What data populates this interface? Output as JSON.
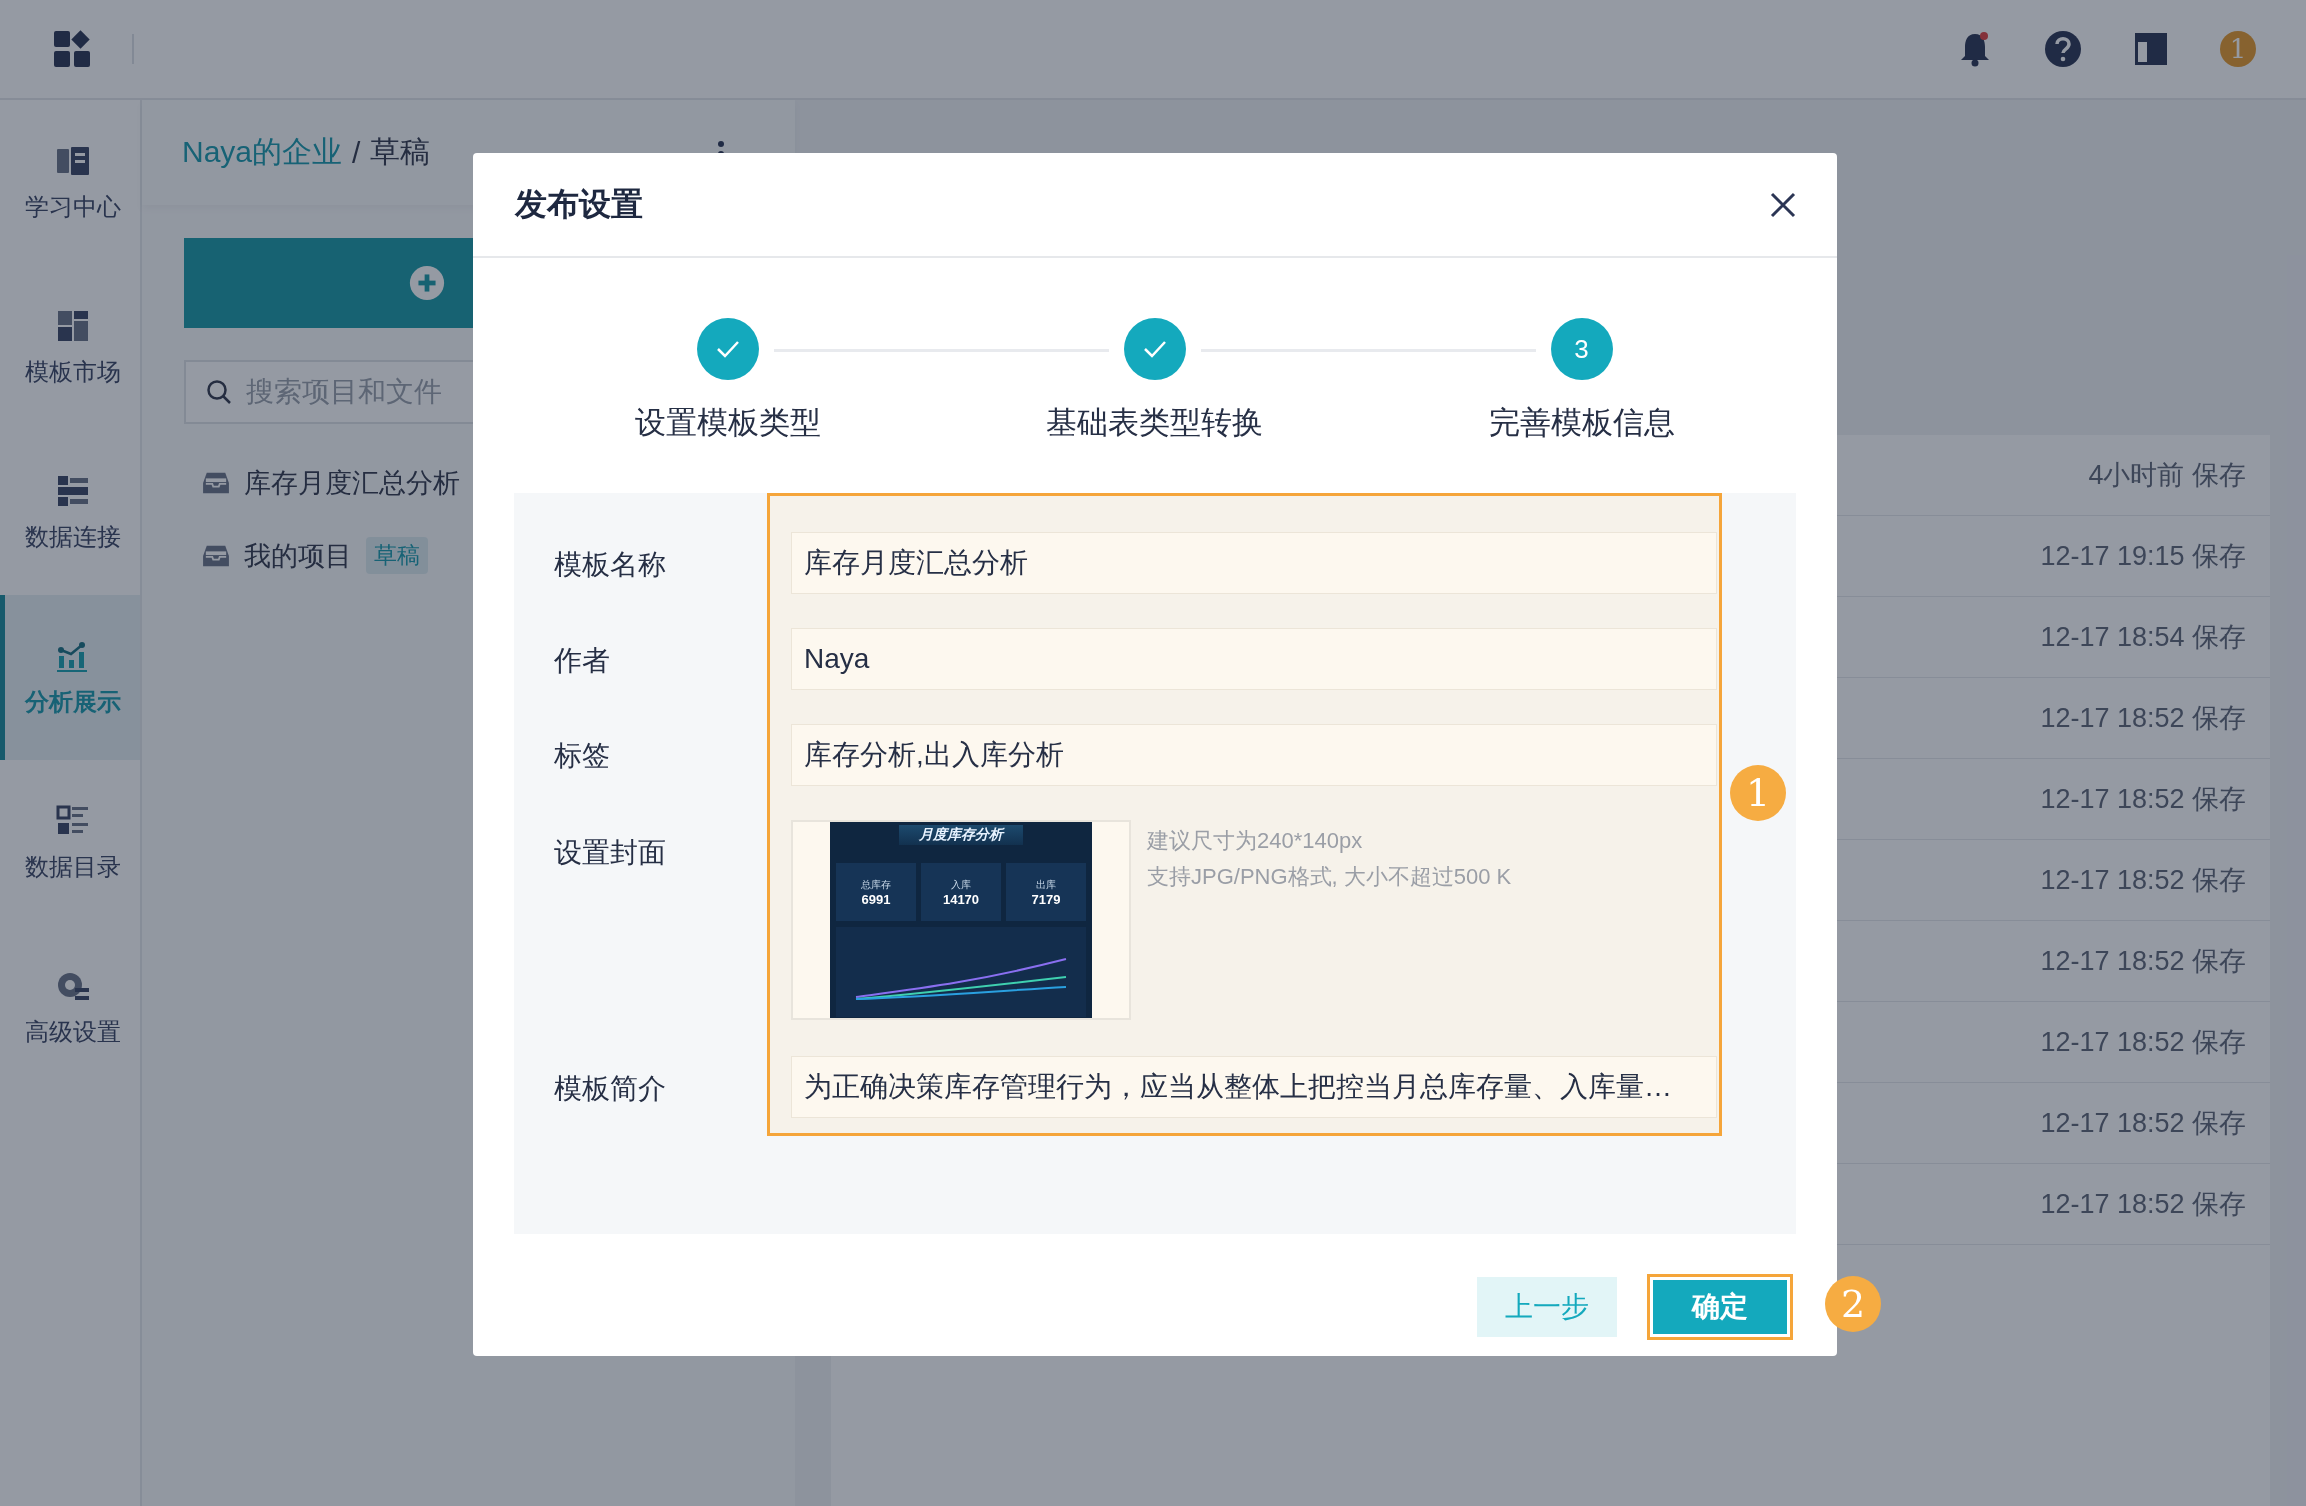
{
  "topbar": {
    "badge": "1"
  },
  "sidebar": {
    "items": [
      {
        "label": "学习中心",
        "selected": false
      },
      {
        "label": "模板市场",
        "selected": false
      },
      {
        "label": "数据连接",
        "selected": false
      },
      {
        "label": "分析展示",
        "selected": true
      },
      {
        "label": "数据目录",
        "selected": false
      },
      {
        "label": "高级设置",
        "selected": false
      }
    ]
  },
  "breadcrumb": {
    "link": "Naya的企业",
    "separator": "/",
    "current": "草稿"
  },
  "search": {
    "placeholder": "搜索项目和文件"
  },
  "tree": [
    {
      "label": "库存月度汇总分析"
    },
    {
      "label": "我的项目",
      "tag": "草稿"
    }
  ],
  "recent": [
    {
      "time": "4小时前 保存"
    },
    {
      "time": "12-17 19:15 保存"
    },
    {
      "time": "12-17 18:54 保存"
    },
    {
      "time": "12-17 18:52 保存"
    },
    {
      "time": "12-17 18:52 保存"
    },
    {
      "time": "12-17 18:52 保存"
    },
    {
      "time": "12-17 18:52 保存"
    },
    {
      "time": "12-17 18:52 保存"
    },
    {
      "time": "12-17 18:52 保存"
    },
    {
      "time": "12-17 18:52 保存"
    }
  ],
  "dialog": {
    "title": "发布设置",
    "steps": [
      {
        "label": "设置模板类型",
        "done": true
      },
      {
        "label": "基础表类型转换",
        "done": true
      },
      {
        "label": "完善模板信息",
        "done": false,
        "number": "3"
      }
    ],
    "fields": [
      {
        "kind": "text",
        "label": "模板名称",
        "value": "库存月度汇总分析"
      },
      {
        "kind": "text",
        "label": "作者",
        "value": "Naya"
      },
      {
        "kind": "text",
        "label": "标签",
        "value": "库存分析,出入库分析"
      },
      {
        "kind": "cover",
        "label": "设置封面",
        "hints": [
          "建议尺寸为240*140px",
          "支持JPG/PNG格式, 大小不超过500 K"
        ],
        "cover": {
          "title": "月度库存分析",
          "stats": [
            {
              "label": "总库存",
              "value": "6991"
            },
            {
              "label": "入库",
              "value": "14170"
            },
            {
              "label": "出库",
              "value": "7179"
            }
          ]
        }
      },
      {
        "kind": "text",
        "label": "模板简介",
        "value": "为正确决策库存管理行为，应当从整体上把控当月总库存量、入库量…"
      }
    ],
    "form_badge": "1",
    "buttons": [
      {
        "label": "上一步",
        "kind": "secondary",
        "highlighted": false
      },
      {
        "label": "确定",
        "kind": "primary",
        "highlighted": true
      }
    ],
    "button_badge": "2"
  }
}
